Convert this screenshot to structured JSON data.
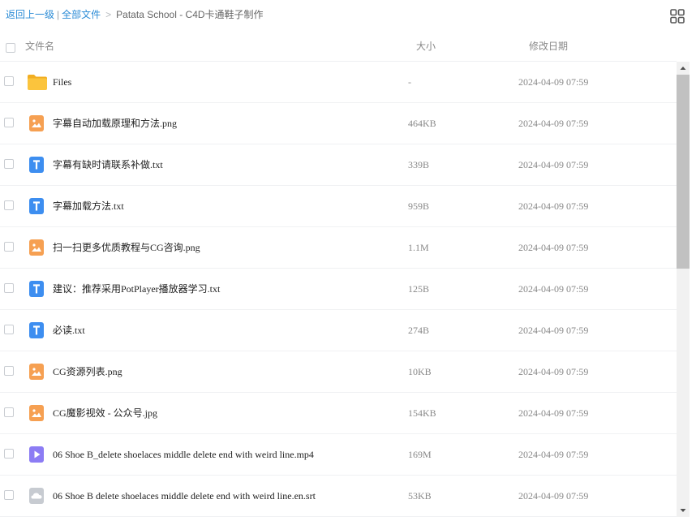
{
  "breadcrumb": {
    "back_label": "返回上一级",
    "separator": "|",
    "all_files_label": "全部文件",
    "arrow": ">",
    "current": "Patata School - C4D卡通鞋子制作"
  },
  "header": {
    "name": "文件名",
    "size": "大小",
    "date": "修改日期"
  },
  "icons": {
    "folder": "folder-icon",
    "image": "image-file-icon",
    "text": "text-file-icon",
    "video": "video-file-icon",
    "subtitle": "cloud-file-icon",
    "view": "grid-view-icon"
  },
  "colors": {
    "link": "#2a8bd6",
    "folder": "#fbc43d",
    "image": "#f6a052",
    "text": "#3d8ef0",
    "video": "#8c7cf4",
    "subtitle": "#c7cbd1"
  },
  "files": [
    {
      "name": "Files",
      "size": "-",
      "date": "2024-04-09 07:59",
      "type": "folder"
    },
    {
      "name": "字幕自动加载原理和方法.png",
      "size": "464KB",
      "date": "2024-04-09 07:59",
      "type": "image"
    },
    {
      "name": "字幕有缺时请联系补做.txt",
      "size": "339B",
      "date": "2024-04-09 07:59",
      "type": "text"
    },
    {
      "name": "字幕加载方法.txt",
      "size": "959B",
      "date": "2024-04-09 07:59",
      "type": "text"
    },
    {
      "name": "扫一扫更多优质教程与CG咨询.png",
      "size": "1.1M",
      "date": "2024-04-09 07:59",
      "type": "image"
    },
    {
      "name": "建议：推荐采用PotPlayer播放器学习.txt",
      "size": "125B",
      "date": "2024-04-09 07:59",
      "type": "text"
    },
    {
      "name": "必读.txt",
      "size": "274B",
      "date": "2024-04-09 07:59",
      "type": "text"
    },
    {
      "name": "CG资源列表.png",
      "size": "10KB",
      "date": "2024-04-09 07:59",
      "type": "image"
    },
    {
      "name": "CG魔影视效 - 公众号.jpg",
      "size": "154KB",
      "date": "2024-04-09 07:59",
      "type": "image"
    },
    {
      "name": "06 Shoe B_delete shoelaces middle delete end with weird line.mp4",
      "size": "169M",
      "date": "2024-04-09 07:59",
      "type": "video"
    },
    {
      "name": "06 Shoe B delete shoelaces middle delete end with weird line.en.srt",
      "size": "53KB",
      "date": "2024-04-09 07:59",
      "type": "subtitle"
    }
  ]
}
